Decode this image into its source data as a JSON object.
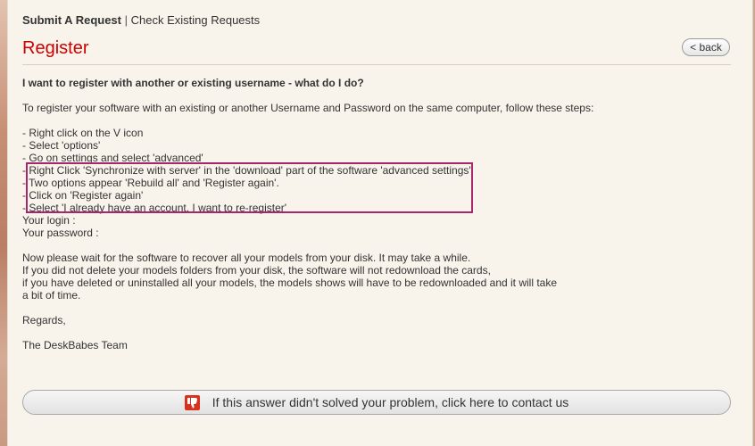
{
  "nav": {
    "submit": "Submit A Request",
    "separator": "|",
    "check": "Check Existing Requests"
  },
  "page": {
    "title": "Register",
    "back_label": "< back"
  },
  "article": {
    "question": "I want to register with another or existing username - what do I do?",
    "intro": "To register your software with an existing or another Username and Password on the same computer, follow these steps:",
    "steps": [
      "- Right click on the V icon",
      "- Select 'options'",
      "- Go on settings and select 'advanced'"
    ],
    "highlighted_steps": [
      "- Right Click 'Synchronize with server' in the 'download' part of the software 'advanced settings'",
      "- Two options appear 'Rebuild all' and 'Register again'.",
      "- Click on 'Register again'",
      "- Select 'I already have an account, I want to re-register'"
    ],
    "login_label": "Your login :",
    "password_label": "Your password :",
    "paragraph": [
      "Now please wait for the software to recover all your models from your disk. It may take a while.",
      "If you did not delete your models folders from your disk, the software will not redownload the cards,",
      "if you have deleted or uninstalled all your models, the models shows will have to be redownloaded and it will take",
      "a bit of time."
    ],
    "regards": "Regards,",
    "signature": "The DeskBabes Team"
  },
  "contact": {
    "label": "If this answer didn't solved your problem, click here to contact us",
    "icon": "thumbs-down-icon"
  },
  "colors": {
    "title": "#cc0000",
    "highlight_border": "#a9266c",
    "icon_red": "#d8321e"
  }
}
